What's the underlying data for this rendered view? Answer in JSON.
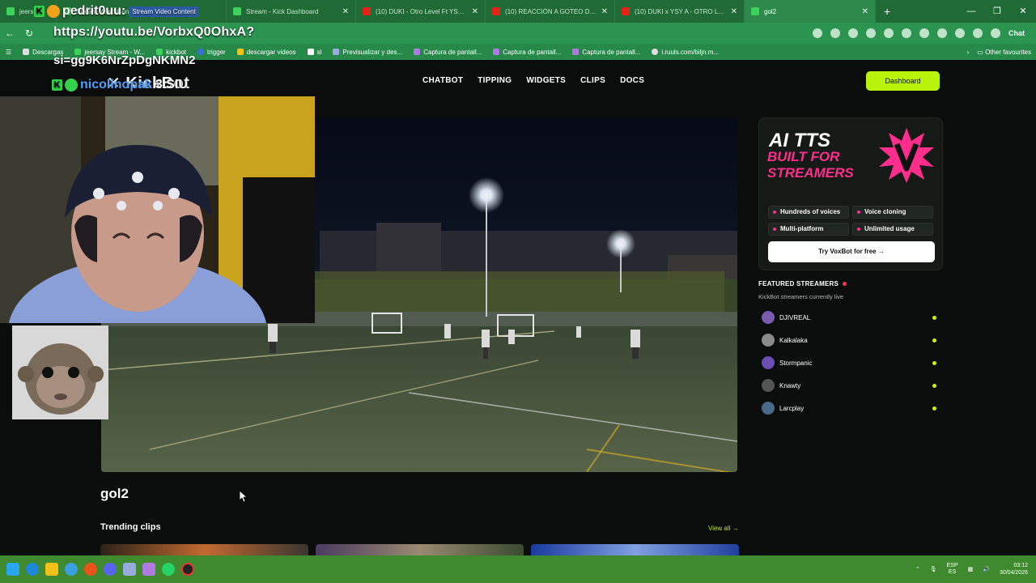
{
  "browser": {
    "tabs": [
      {
        "label": "jeers",
        "active": false,
        "color": "#3bd15a"
      },
      {
        "label": "Stream Video Content",
        "active": false,
        "color": "#3bd15a"
      },
      {
        "label": "Stream - Kick Dashboard",
        "active": false,
        "color": "#3bd15a"
      },
      {
        "label": "(10) DUKI - Otro Level Ft YSY A S...",
        "active": false,
        "color": "#e62117"
      },
      {
        "label": "(10) REACCIÓN A GOTEO DUKI x C...",
        "active": false,
        "color": "#e62117"
      },
      {
        "label": "(10) DUKI x YSY A - OTRO LEVEL -...",
        "active": false,
        "color": "#e62117"
      },
      {
        "label": "gol2",
        "active": true,
        "color": "#3bd15a"
      }
    ],
    "new_tab_icon": "plus-icon",
    "bookmarks": [
      {
        "label": "Descargas",
        "icon": "globe-icon"
      },
      {
        "label": "jeersay Stream - W...",
        "icon": "kick-icon"
      },
      {
        "label": "kickbot",
        "icon": "kick-icon"
      },
      {
        "label": "trigger",
        "icon": "drop-icon"
      },
      {
        "label": "descargar videos",
        "icon": "bolt-icon"
      },
      {
        "label": "sl",
        "icon": "box-icon"
      },
      {
        "label": "Previsualizar y des...",
        "icon": "rp-icon"
      },
      {
        "label": "Captura de pantall...",
        "icon": "pen-icon"
      },
      {
        "label": "Captura de pantall...",
        "icon": "pen-icon"
      },
      {
        "label": "Captura de pantall...",
        "icon": "pen-icon"
      },
      {
        "label": "i.ruuls.com/biljn.m...",
        "icon": "globe-icon"
      }
    ],
    "other_favourites": "Other favourites",
    "chat_label": "Chat"
  },
  "overlay": {
    "user_name": "pedrit0uu:",
    "badge": "Stream Video Content",
    "link_line1": "https://youtu.be/VorbxQ0OhxA?",
    "link_line2": "si=gg9K6NrZpDgNKMN2",
    "user2_name": "nicolinopak",
    "user2_suffix": "3 SIU"
  },
  "site": {
    "logo": "KickBot",
    "nav": [
      "CHATBOT",
      "TIPPING",
      "WIDGETS",
      "CLIPS",
      "DOCS"
    ],
    "dashboard_button": "Dashboard",
    "clip_title": "gol2",
    "trending_title": "Trending clips",
    "view_all": "View all →"
  },
  "ad": {
    "headline1": "AI TTS",
    "headline2": "BUILT FOR STREAMERS",
    "features": [
      "Hundreds of voices",
      "Voice cloning",
      "Multi-platform",
      "Unlimited usage"
    ],
    "button": "Try VoxBot for free →",
    "accent_color": "#ff2d8c"
  },
  "featured": {
    "heading": "FEATURED STREAMERS",
    "subtitle": "KickBot streamers currently live",
    "streamers": [
      {
        "name": "DJIVREAL",
        "avatar_color": "#7a5bb0"
      },
      {
        "name": "Kalkalaka",
        "avatar_color": "#8a8a8a"
      },
      {
        "name": "Stormpanic",
        "avatar_color": "#6a4fb0"
      },
      {
        "name": "Knawty",
        "avatar_color": "#555555"
      },
      {
        "name": "Larcplay",
        "avatar_color": "#4a6a8a"
      }
    ],
    "live_color": "#c6f21a"
  },
  "taskbar": {
    "lang_line1": "ESP",
    "lang_line2": "ES",
    "time": "03:12",
    "date": "30/04/2026"
  },
  "colors": {
    "brand": "#b9f20a",
    "page_bg": "#0b0d0c",
    "chrome_green": "#2b9450"
  }
}
